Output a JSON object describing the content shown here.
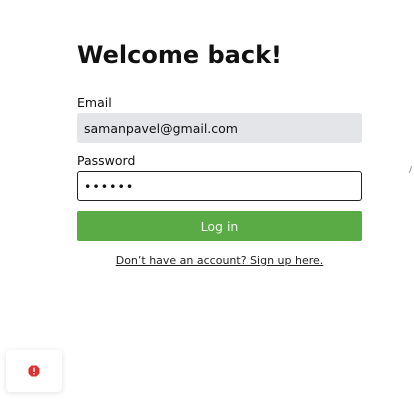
{
  "form": {
    "title": "Welcome back!",
    "email_label": "Email",
    "email_value": "samanpavel@gmail.com",
    "password_label": "Password",
    "password_value": "••••••",
    "login_label": "Log in",
    "signup_text": "Don’t have an account? Sign up here."
  },
  "widget": {
    "icon": "alert-octagon-icon",
    "icon_color": "#e03131"
  },
  "colors": {
    "primary_button": "#5aab46",
    "input_fill": "#e4e5e8"
  }
}
